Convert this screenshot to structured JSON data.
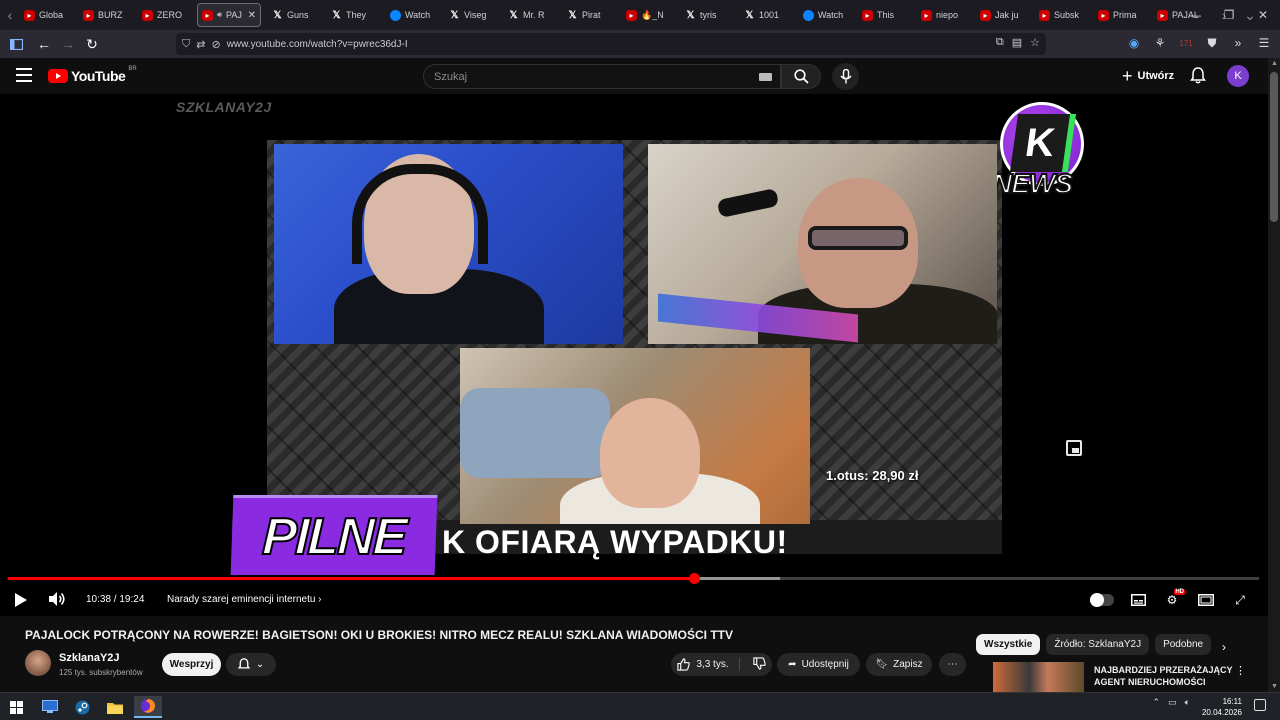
{
  "browser": {
    "tabs": [
      {
        "label": "Globa",
        "icon": "youtube"
      },
      {
        "label": "BURZ",
        "icon": "youtube"
      },
      {
        "label": "ZERO",
        "icon": "youtube"
      },
      {
        "label": "PAJ",
        "icon": "youtube",
        "active": true
      },
      {
        "label": "Guns",
        "icon": "x"
      },
      {
        "label": "They",
        "icon": "x"
      },
      {
        "label": "Watch",
        "icon": "web"
      },
      {
        "label": "Viseg",
        "icon": "x"
      },
      {
        "label": "Mr. R",
        "icon": "x"
      },
      {
        "label": "Pirat",
        "icon": "x"
      },
      {
        "label": "🔥_N",
        "icon": "youtube"
      },
      {
        "label": "tyris",
        "icon": "x"
      },
      {
        "label": "1001",
        "icon": "x"
      },
      {
        "label": "Watch",
        "icon": "web"
      },
      {
        "label": "This",
        "icon": "youtube"
      },
      {
        "label": "niepo",
        "icon": "youtube"
      },
      {
        "label": "Jak ju",
        "icon": "youtube"
      },
      {
        "label": "Subsk",
        "icon": "youtube"
      },
      {
        "label": "Prima",
        "icon": "youtube"
      },
      {
        "label": "PAJAL",
        "icon": "youtube"
      }
    ],
    "url": "www.youtube.com/watch?v=pwrec36dJ-I",
    "extension_badge": "171"
  },
  "youtube": {
    "logo_text": "YouTube",
    "region": "BR",
    "search_placeholder": "Szukaj",
    "create_label": "Utwórz",
    "avatar_letter": "K"
  },
  "video": {
    "overlay_brand": "SZKLANAY2J",
    "news_logo_text": "NEWS",
    "price_text": "1.otus: 28,90 zł",
    "ticker_text": "K OFIARĄ WYPADKU!",
    "pilne_text": "PILNE",
    "current_time": "10:38",
    "duration": "19:24",
    "time_display": "10:38 / 19:24",
    "chapter": "Narady szarej eminencji internetu",
    "progress_fraction": 0.5481,
    "buffered_fraction": 0.6169
  },
  "info": {
    "title": "PAJALOCK POTRĄCONY NA ROWERZE! BAGIETSON! OKI U BROKIES! NITRO MECZ REALU! SZKLANA WIADOMOŚCI TTV",
    "channel_name": "SzklanaY2J",
    "subscribers": "125 tys. subskrybentów",
    "support_label": "Wesprzyj",
    "likes": "3,3 tys.",
    "share_label": "Udostępnij",
    "save_label": "Zapisz"
  },
  "sidebar": {
    "chips": [
      "Wszystkie",
      "Źródło: SzklanaY2J",
      "Podobne"
    ],
    "rec_title": "NAJBARDZIEJ PRZERAŻAJĄCY AGENT NIERUCHOMOŚCI"
  },
  "taskbar": {
    "time": "16:11",
    "date": "20.04.2026"
  },
  "colors": {
    "youtube_red": "#ff0000",
    "purple_banner": "#8a2be2",
    "background": "#0f0f0f"
  }
}
